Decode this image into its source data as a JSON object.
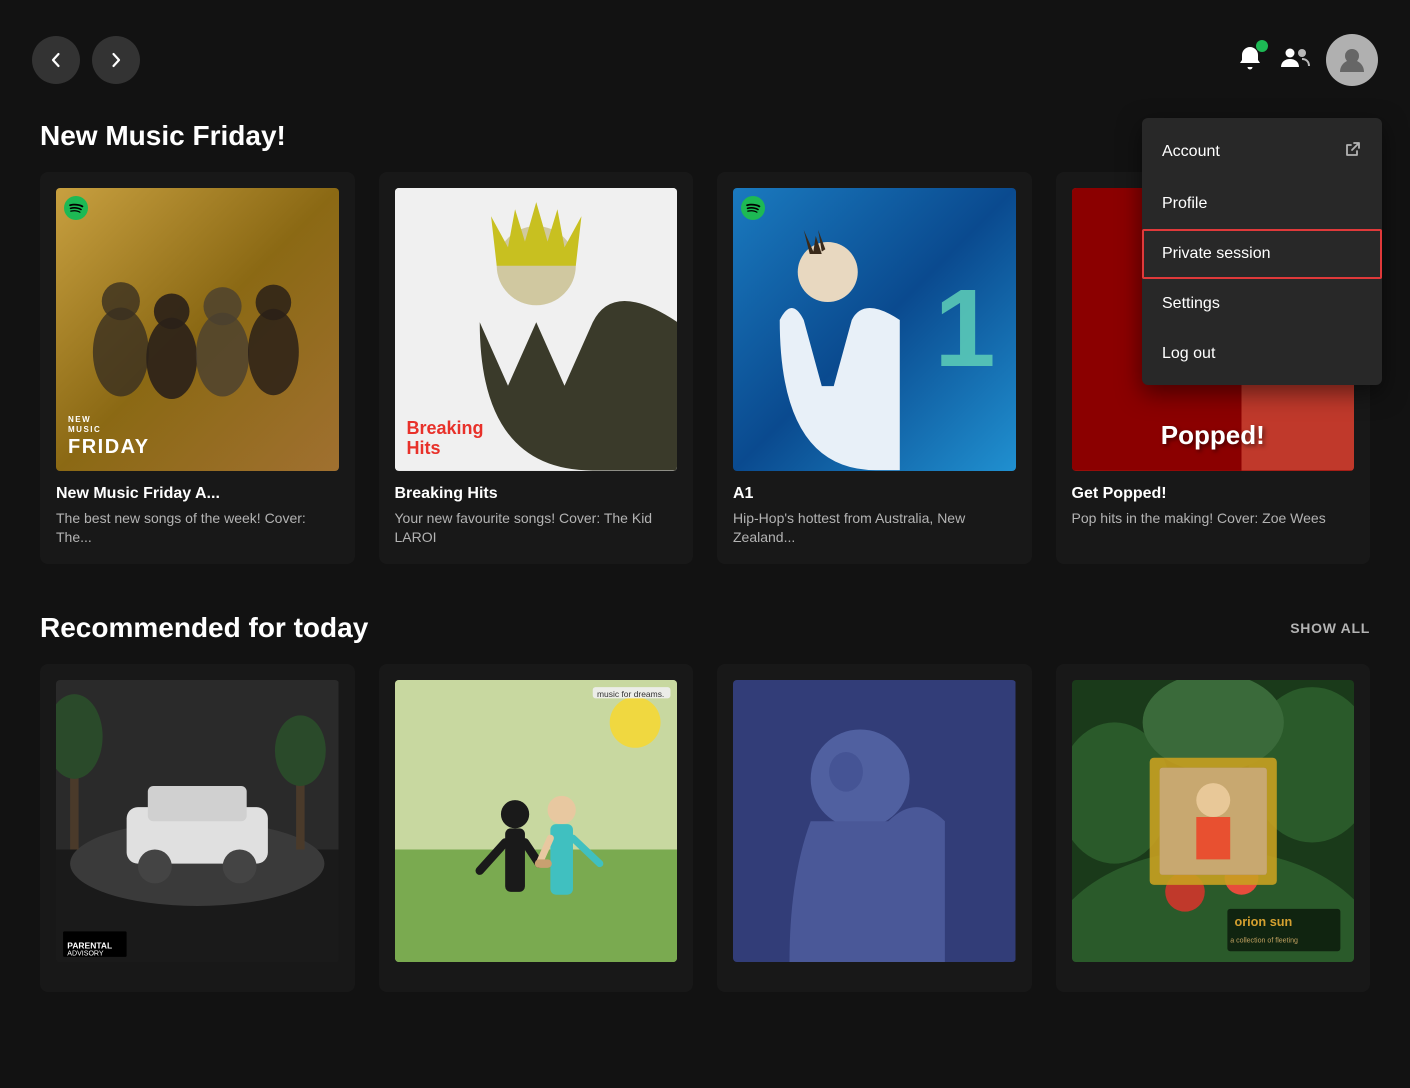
{
  "topbar": {
    "back_label": "‹",
    "forward_label": "›"
  },
  "dropdown": {
    "account_label": "Account",
    "profile_label": "Profile",
    "private_session_label": "Private session",
    "settings_label": "Settings",
    "logout_label": "Log out"
  },
  "section1": {
    "title": "New Music Friday!",
    "cards": [
      {
        "title": "New Music Friday A...",
        "subtitle": "The best new songs of the week! Cover: The..."
      },
      {
        "title": "Breaking Hits",
        "subtitle": "Your new favourite songs! Cover: The Kid LAROI"
      },
      {
        "title": "A1",
        "subtitle": "Hip-Hop's hottest from Australia, New Zealand..."
      },
      {
        "title": "Get Popped!",
        "subtitle": "Pop hits in the making! Cover: Zoe Wees"
      }
    ]
  },
  "section2": {
    "title": "Recommended for today",
    "show_all_label": "Show all",
    "cards": [
      {
        "title": "",
        "subtitle": ""
      },
      {
        "title": "",
        "subtitle": ""
      },
      {
        "title": "",
        "subtitle": ""
      },
      {
        "title": "",
        "subtitle": ""
      }
    ]
  }
}
